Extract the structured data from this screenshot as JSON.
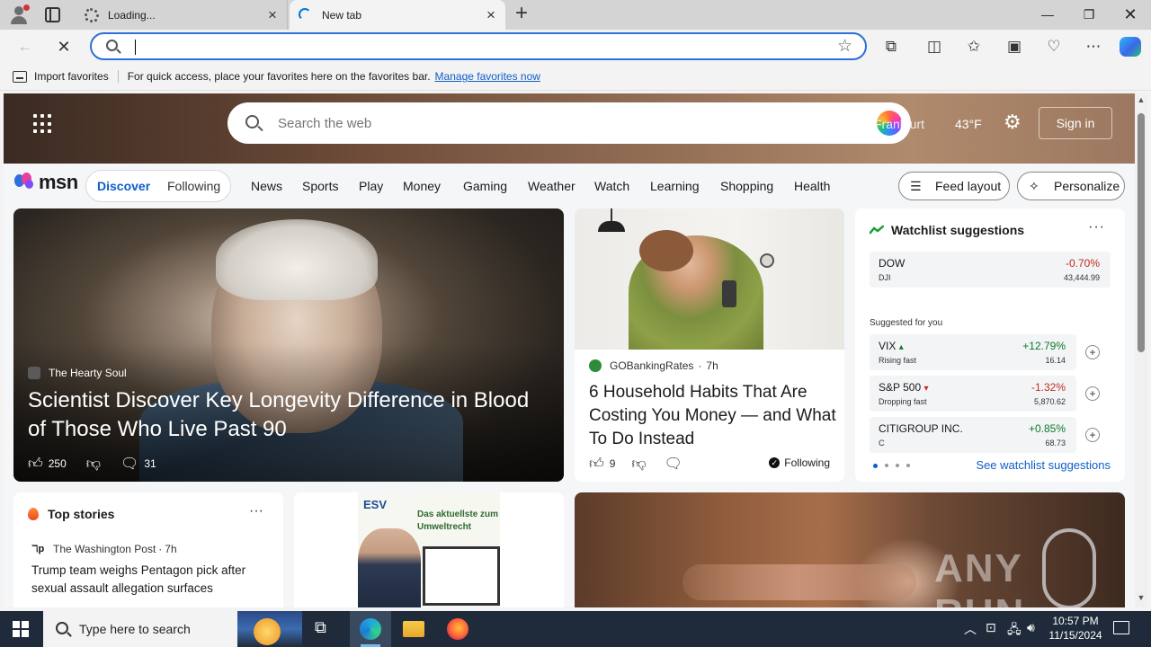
{
  "browser": {
    "tabs": [
      {
        "title": "Loading...",
        "state": "inactive"
      },
      {
        "title": "New tab",
        "state": "active"
      }
    ],
    "address_value": "",
    "favorites_bar": {
      "import_label": "Import favorites",
      "hint": "For quick access, place your favorites here on the favorites bar.",
      "manage_link": "Manage favorites now"
    }
  },
  "msn": {
    "search_placeholder": "Search the web",
    "location": "Frankfurt",
    "temperature": "43°F",
    "sign_in": "Sign in",
    "logo_text": "msn",
    "segments": [
      "Discover",
      "Following"
    ],
    "nav": [
      "News",
      "Sports",
      "Play",
      "Money",
      "Gaming",
      "Weather",
      "Watch",
      "Learning",
      "Shopping",
      "Health"
    ],
    "feed_layout": "Feed layout",
    "personalize": "Personalize",
    "hero_story": {
      "source": "The Hearty Soul",
      "title": "Scientist Discover Key Longevity Difference in Blood of Those Who Live Past 90",
      "likes": "250",
      "comments": "31"
    },
    "second_story": {
      "source": "GOBankingRates",
      "age": "7h",
      "title": "6 Household Habits That Are Costing You Money — and What To Do Instead",
      "likes": "9",
      "following": "Following"
    },
    "watchlist": {
      "title": "Watchlist suggestions",
      "main": {
        "name": "DOW",
        "symbol": "DJI",
        "change": "-0.70%",
        "value": "43,444.99"
      },
      "suggested_label": "Suggested for you",
      "suggestions": [
        {
          "name": "VIX",
          "tag": "Rising fast",
          "change": "+12.79%",
          "value": "16.14",
          "dir": "up"
        },
        {
          "name": "S&P 500",
          "tag": "Dropping fast",
          "change": "-1.32%",
          "value": "5,870.62",
          "dir": "down"
        },
        {
          "name": "CITIGROUP INC.",
          "tag": "C",
          "change": "+0.85%",
          "value": "68.73",
          "dir": "up"
        }
      ],
      "link": "See watchlist suggestions"
    },
    "top_stories": {
      "title": "Top stories",
      "source": "The Washington Post",
      "age": "7h",
      "headline": "Trump team weighs Pentagon pick after sexual assault allegation surfaces"
    },
    "ad": {
      "brand": "ESV",
      "headline": "Das aktuellste zum Umweltrecht"
    },
    "watermark": "ANY RUN"
  },
  "taskbar": {
    "search_placeholder": "Type here to search",
    "time": "10:57 PM",
    "date": "11/15/2024"
  }
}
